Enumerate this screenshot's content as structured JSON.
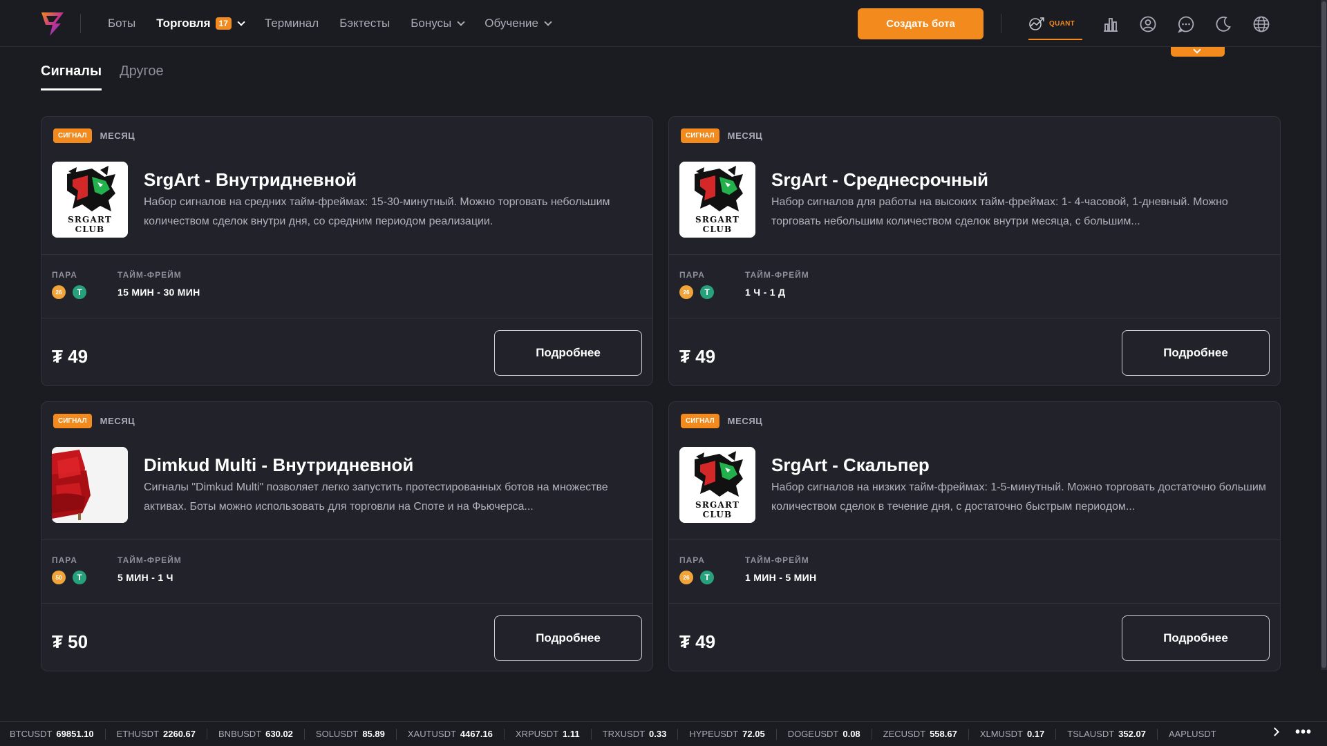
{
  "nav": {
    "items": [
      {
        "label": "Боты"
      },
      {
        "label": "Торговля",
        "badge": "17"
      },
      {
        "label": "Терминал"
      },
      {
        "label": "Бэктесты"
      },
      {
        "label": "Бонусы"
      },
      {
        "label": "Обучение"
      }
    ],
    "create_button": "Создать бота",
    "quant_label": "QUANT"
  },
  "tabs": [
    {
      "label": "Сигналы",
      "active": true
    },
    {
      "label": "Другое",
      "active": false
    }
  ],
  "labels": {
    "pair": "ПАРА",
    "timeframe": "ТАЙМ-ФРЕЙМ",
    "more": "Подробнее"
  },
  "cards": [
    {
      "tag": "СИГНАЛ",
      "period": "МЕСЯЦ",
      "title": "SrgArt - Внутридневной",
      "description": "Набор сигналов на средних тайм-фреймах: 15-30-минутный. Можно торговать небольшим количеством сделок внутри дня, со средним периодом реализации.",
      "coin_a": "26",
      "coin_b": "T",
      "timeframe": "15 МИН - 30 МИН",
      "price": "₮ 49",
      "image": "srgart-club-logo"
    },
    {
      "tag": "СИГНАЛ",
      "period": "МЕСЯЦ",
      "title": "SrgArt - Среднесрочный",
      "description": "Набор сигналов для работы на высоких тайм-фреймах: 1- 4-часовой, 1-дневный. Можно торговать небольшим количеством сделок внутри месяца, с большим...",
      "coin_a": "26",
      "coin_b": "T",
      "timeframe": "1 Ч - 1 Д",
      "price": "₮ 49",
      "image": "srgart-club-logo"
    },
    {
      "tag": "СИГНАЛ",
      "period": "МЕСЯЦ",
      "title": "Dimkud Multi - Внутридневной",
      "description": "Сигналы \"Dimkud Multi\" позволяет легко запустить протестированных ботов на множестве активах. Боты можно использовать для торговли на Споте и на Фьючерса...",
      "coin_a": "50",
      "coin_b": "T",
      "timeframe": "5 МИН - 1 Ч",
      "price": "₮ 50",
      "image": "red-armchair"
    },
    {
      "tag": "СИГНАЛ",
      "period": "МЕСЯЦ",
      "title": "SrgArt - Скальпер",
      "description": "Набор сигналов на низких тайм-фреймах: 1-5-минутный. Можно торговать достаточно большим количеством сделок в течение дня, с достаточно быстрым периодом...",
      "coin_a": "26",
      "coin_b": "T",
      "timeframe": "1 МИН - 5 МИН",
      "price": "₮ 49",
      "image": "srgart-club-logo"
    }
  ],
  "logo_text": {
    "line1": "SRGART",
    "line2": "CLUB"
  },
  "ticker": [
    {
      "symbol": "BTCUSDT",
      "value": "69851.10"
    },
    {
      "symbol": "ETHUSDT",
      "value": "2260.67"
    },
    {
      "symbol": "BNBUSDT",
      "value": "630.02"
    },
    {
      "symbol": "SOLUSDT",
      "value": "85.89"
    },
    {
      "symbol": "XAUTUSDT",
      "value": "4467.16"
    },
    {
      "symbol": "XRPUSDT",
      "value": "1.11"
    },
    {
      "symbol": "TRXUSDT",
      "value": "0.33"
    },
    {
      "symbol": "HYPEUSDT",
      "value": "72.05"
    },
    {
      "symbol": "DOGEUSDT",
      "value": "0.08"
    },
    {
      "symbol": "ZECUSDT",
      "value": "558.67"
    },
    {
      "symbol": "XLMUSDT",
      "value": "0.17"
    },
    {
      "symbol": "TSLAUSDT",
      "value": "352.07"
    },
    {
      "symbol": "AAPLUSDT",
      "value": ""
    }
  ],
  "ticker_more": "•••",
  "colors": {
    "accent": "#f28a1d",
    "background": "#1b1c22",
    "card": "#22232a"
  }
}
